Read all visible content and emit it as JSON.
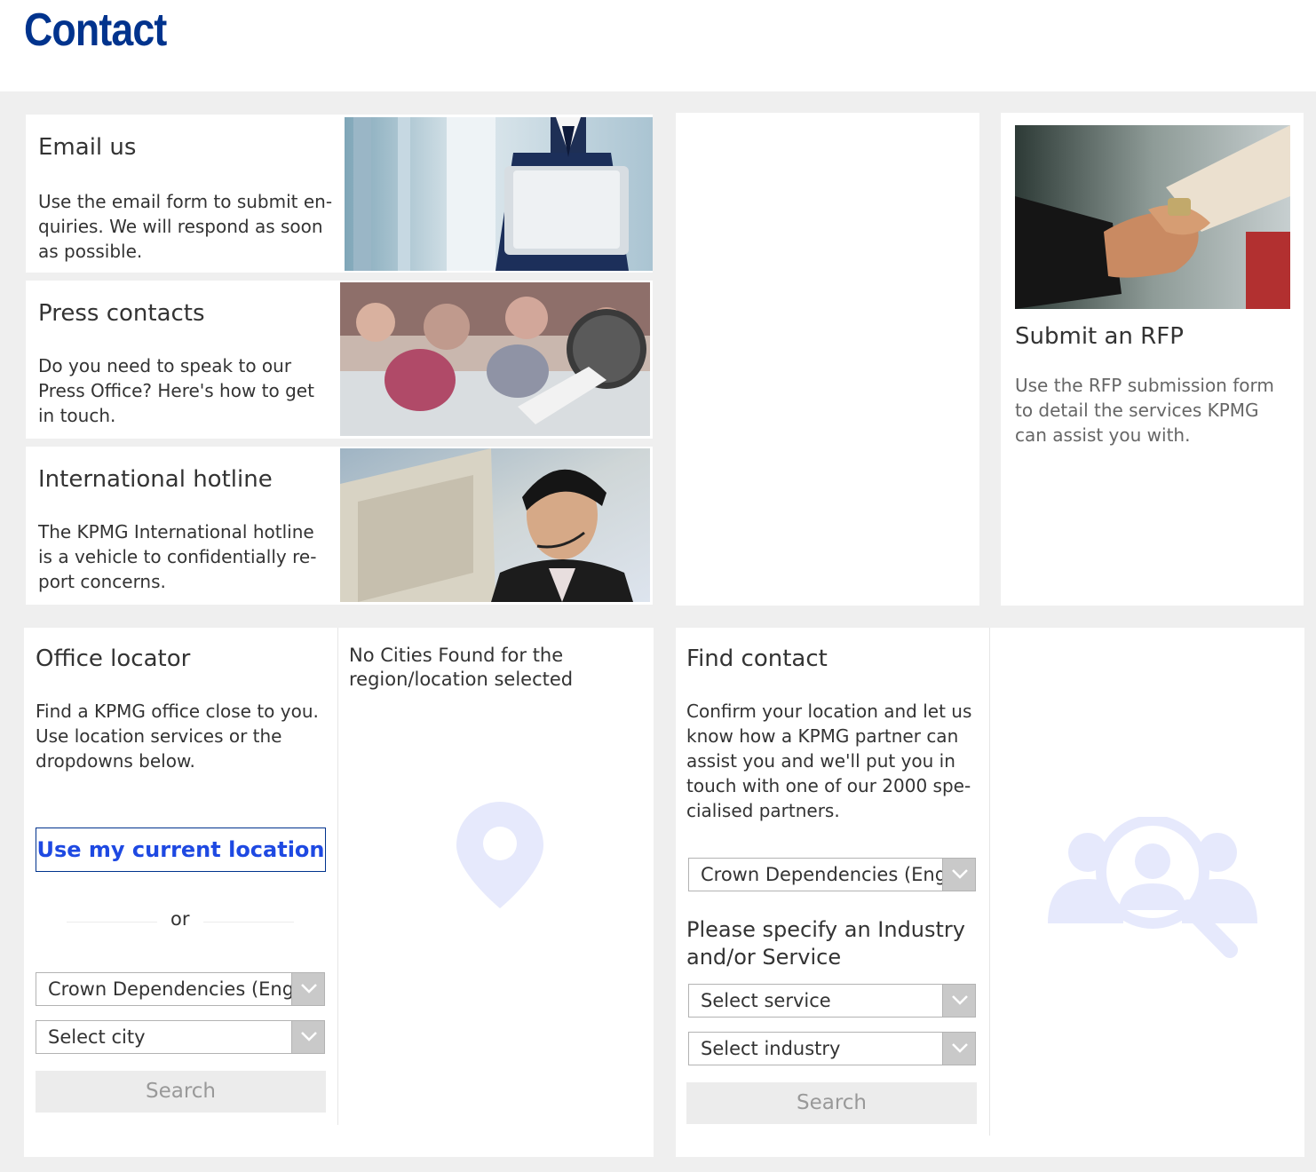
{
  "page": {
    "title": "Contact"
  },
  "email": {
    "title": "Email us",
    "description": "Use the email form to submit en­quiries. We will respond as soon as possible."
  },
  "press": {
    "title": "Press contacts",
    "description": "Do you need to speak to our Press Office? Here's how to get in touch."
  },
  "hotline": {
    "title": "International hotline",
    "description": "The KPMG International hotline is a vehicle to confidentially re­port concerns."
  },
  "rfp": {
    "title": "Submit an RFP",
    "description": "Use the RFP submission form to detail the services KPMG can assist you with."
  },
  "office_locator": {
    "title": "Office locator",
    "description": "Find a KPMG office close to you. Use location services or the dropdowns below.",
    "location_button": "Use my current location",
    "or_label": "or",
    "region_select": "Crown Dependencies (English)",
    "city_select": "Select city",
    "search_button": "Search",
    "no_results": "No Cities Found for the region/location selected"
  },
  "find_contact": {
    "title": "Find contact",
    "description": "Confirm your location and let us know how a KPMG partner can assist you and we'll put you in touch with one of our 2000 spe­cialised partners.",
    "region_select": "Crown Dependencies (English)",
    "industry_heading": "Please specify an Industry and/or Service",
    "service_select": "Select service",
    "industry_select": "Select industry",
    "search_button": "Search"
  },
  "icons": {
    "map_pin": "map-pin-icon",
    "people_search": "people-search-icon",
    "dropdown": "chevron-down-icon"
  },
  "colors": {
    "brand": "#00338d",
    "link_blue": "#1e49e2",
    "icon_tint": "#e6e9fc"
  }
}
